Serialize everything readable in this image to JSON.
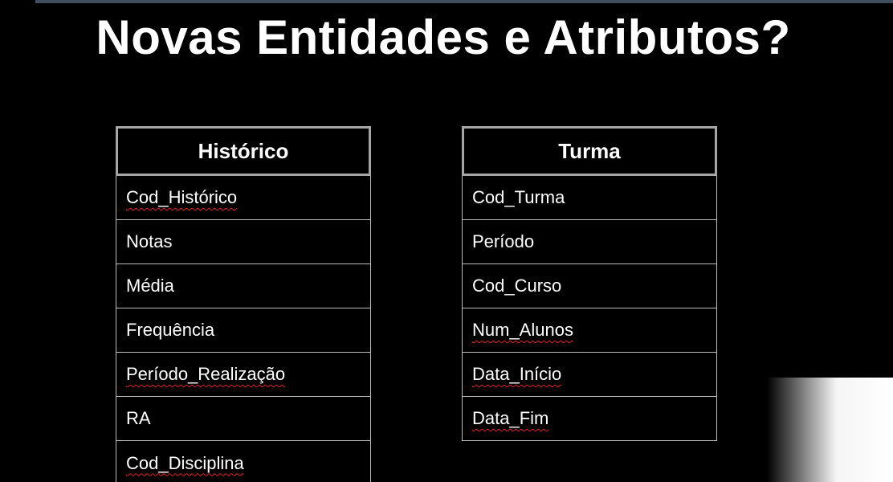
{
  "slide": {
    "title": "Novas Entidades e Atributos?"
  },
  "entities": [
    {
      "name": "Histórico",
      "attributes": [
        {
          "label": "Cod_Histórico",
          "flagged": true
        },
        {
          "label": "Notas",
          "flagged": false
        },
        {
          "label": "Média",
          "flagged": false
        },
        {
          "label": "Frequência",
          "flagged": false
        },
        {
          "label": "Período_Realização",
          "flagged": true
        },
        {
          "label": "RA",
          "flagged": false
        },
        {
          "label": "Cod_Disciplina",
          "flagged": true
        }
      ]
    },
    {
      "name": "Turma",
      "attributes": [
        {
          "label": "Cod_Turma",
          "flagged": false
        },
        {
          "label": "Período",
          "flagged": false
        },
        {
          "label": "Cod_Curso",
          "flagged": false
        },
        {
          "label": "Num_Alunos",
          "flagged": true
        },
        {
          "label": "Data_Início",
          "flagged": true
        },
        {
          "label": "Data_Fim",
          "flagged": true
        }
      ]
    }
  ],
  "colors": {
    "background": "#000000",
    "text": "#ffffff",
    "header_border": "#a6a6a6",
    "row_border": "#bcbcbc",
    "spellcheck_underline": "#e02020"
  }
}
